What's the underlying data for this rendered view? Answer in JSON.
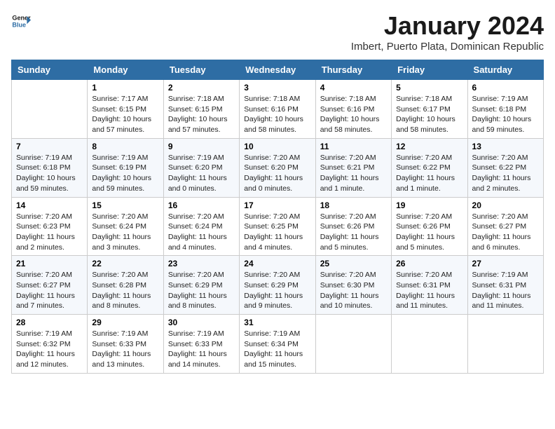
{
  "header": {
    "logo_line1": "General",
    "logo_line2": "Blue",
    "title": "January 2024",
    "subtitle": "Imbert, Puerto Plata, Dominican Republic"
  },
  "calendar": {
    "days_of_week": [
      "Sunday",
      "Monday",
      "Tuesday",
      "Wednesday",
      "Thursday",
      "Friday",
      "Saturday"
    ],
    "weeks": [
      [
        {
          "day": "",
          "info": ""
        },
        {
          "day": "1",
          "info": "Sunrise: 7:17 AM\nSunset: 6:15 PM\nDaylight: 10 hours\nand 57 minutes."
        },
        {
          "day": "2",
          "info": "Sunrise: 7:18 AM\nSunset: 6:15 PM\nDaylight: 10 hours\nand 57 minutes."
        },
        {
          "day": "3",
          "info": "Sunrise: 7:18 AM\nSunset: 6:16 PM\nDaylight: 10 hours\nand 58 minutes."
        },
        {
          "day": "4",
          "info": "Sunrise: 7:18 AM\nSunset: 6:16 PM\nDaylight: 10 hours\nand 58 minutes."
        },
        {
          "day": "5",
          "info": "Sunrise: 7:18 AM\nSunset: 6:17 PM\nDaylight: 10 hours\nand 58 minutes."
        },
        {
          "day": "6",
          "info": "Sunrise: 7:19 AM\nSunset: 6:18 PM\nDaylight: 10 hours\nand 59 minutes."
        }
      ],
      [
        {
          "day": "7",
          "info": "Sunrise: 7:19 AM\nSunset: 6:18 PM\nDaylight: 10 hours\nand 59 minutes."
        },
        {
          "day": "8",
          "info": "Sunrise: 7:19 AM\nSunset: 6:19 PM\nDaylight: 10 hours\nand 59 minutes."
        },
        {
          "day": "9",
          "info": "Sunrise: 7:19 AM\nSunset: 6:20 PM\nDaylight: 11 hours\nand 0 minutes."
        },
        {
          "day": "10",
          "info": "Sunrise: 7:20 AM\nSunset: 6:20 PM\nDaylight: 11 hours\nand 0 minutes."
        },
        {
          "day": "11",
          "info": "Sunrise: 7:20 AM\nSunset: 6:21 PM\nDaylight: 11 hours\nand 1 minute."
        },
        {
          "day": "12",
          "info": "Sunrise: 7:20 AM\nSunset: 6:22 PM\nDaylight: 11 hours\nand 1 minute."
        },
        {
          "day": "13",
          "info": "Sunrise: 7:20 AM\nSunset: 6:22 PM\nDaylight: 11 hours\nand 2 minutes."
        }
      ],
      [
        {
          "day": "14",
          "info": "Sunrise: 7:20 AM\nSunset: 6:23 PM\nDaylight: 11 hours\nand 2 minutes."
        },
        {
          "day": "15",
          "info": "Sunrise: 7:20 AM\nSunset: 6:24 PM\nDaylight: 11 hours\nand 3 minutes."
        },
        {
          "day": "16",
          "info": "Sunrise: 7:20 AM\nSunset: 6:24 PM\nDaylight: 11 hours\nand 4 minutes."
        },
        {
          "day": "17",
          "info": "Sunrise: 7:20 AM\nSunset: 6:25 PM\nDaylight: 11 hours\nand 4 minutes."
        },
        {
          "day": "18",
          "info": "Sunrise: 7:20 AM\nSunset: 6:26 PM\nDaylight: 11 hours\nand 5 minutes."
        },
        {
          "day": "19",
          "info": "Sunrise: 7:20 AM\nSunset: 6:26 PM\nDaylight: 11 hours\nand 5 minutes."
        },
        {
          "day": "20",
          "info": "Sunrise: 7:20 AM\nSunset: 6:27 PM\nDaylight: 11 hours\nand 6 minutes."
        }
      ],
      [
        {
          "day": "21",
          "info": "Sunrise: 7:20 AM\nSunset: 6:27 PM\nDaylight: 11 hours\nand 7 minutes."
        },
        {
          "day": "22",
          "info": "Sunrise: 7:20 AM\nSunset: 6:28 PM\nDaylight: 11 hours\nand 8 minutes."
        },
        {
          "day": "23",
          "info": "Sunrise: 7:20 AM\nSunset: 6:29 PM\nDaylight: 11 hours\nand 8 minutes."
        },
        {
          "day": "24",
          "info": "Sunrise: 7:20 AM\nSunset: 6:29 PM\nDaylight: 11 hours\nand 9 minutes."
        },
        {
          "day": "25",
          "info": "Sunrise: 7:20 AM\nSunset: 6:30 PM\nDaylight: 11 hours\nand 10 minutes."
        },
        {
          "day": "26",
          "info": "Sunrise: 7:20 AM\nSunset: 6:31 PM\nDaylight: 11 hours\nand 11 minutes."
        },
        {
          "day": "27",
          "info": "Sunrise: 7:19 AM\nSunset: 6:31 PM\nDaylight: 11 hours\nand 11 minutes."
        }
      ],
      [
        {
          "day": "28",
          "info": "Sunrise: 7:19 AM\nSunset: 6:32 PM\nDaylight: 11 hours\nand 12 minutes."
        },
        {
          "day": "29",
          "info": "Sunrise: 7:19 AM\nSunset: 6:33 PM\nDaylight: 11 hours\nand 13 minutes."
        },
        {
          "day": "30",
          "info": "Sunrise: 7:19 AM\nSunset: 6:33 PM\nDaylight: 11 hours\nand 14 minutes."
        },
        {
          "day": "31",
          "info": "Sunrise: 7:19 AM\nSunset: 6:34 PM\nDaylight: 11 hours\nand 15 minutes."
        },
        {
          "day": "",
          "info": ""
        },
        {
          "day": "",
          "info": ""
        },
        {
          "day": "",
          "info": ""
        }
      ]
    ]
  }
}
